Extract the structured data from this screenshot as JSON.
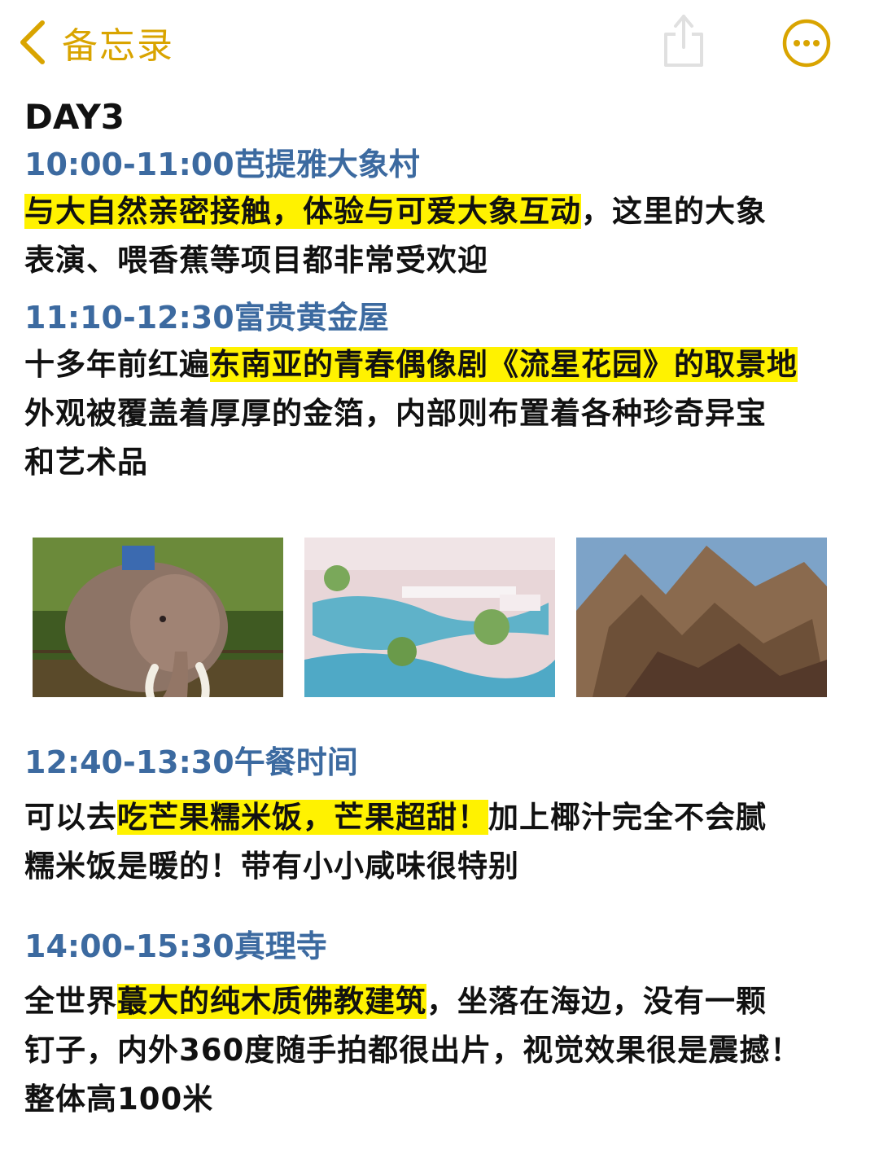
{
  "header": {
    "back_label": "备忘录",
    "accent_color": "#d9a400",
    "icons": [
      "chevron-left-icon",
      "share-icon",
      "more-icon"
    ]
  },
  "note": {
    "day_title": "DAY3",
    "sections": [
      {
        "time": "10:00-11:00芭提雅大象村",
        "lines": [
          {
            "hl": "与大自然亲密接触，体验与可爱大象互动",
            "rest": "，这里的大象"
          },
          {
            "pre": "表演、喂香蕉等项目都非常受欢迎"
          }
        ]
      },
      {
        "time": "11:10-12:30富贵黄金屋",
        "lines": [
          {
            "pre": "十多年前红遍",
            "hl": "东南亚的青春偶像剧《流星花园》的取景地"
          },
          {
            "pre": "外观被覆盖着厚厚的金箔，内部则布置着各种珍奇异宝"
          },
          {
            "pre": "和艺术品"
          }
        ]
      },
      {
        "time": "12:40-13:30午餐时间",
        "lines": [
          {
            "pre": "可以去",
            "hl": "吃芒果糯米饭，芒果超甜！",
            "rest": "加上椰汁完全不会腻"
          },
          {
            "pre": "糯米饭是暖的！带有小小咸味很特别"
          }
        ]
      },
      {
        "time": "14:00-15:30真理寺",
        "lines": [
          {
            "pre": "全世界",
            "hl": "蕞大的纯木质佛教建筑",
            "rest": "，坐落在海边，没有一颗"
          },
          {
            "pre": "钉子，内外360度随手拍都很出片，视觉效果很是震撼！"
          },
          {
            "pre": "整体高100米"
          }
        ]
      }
    ],
    "photos": [
      "elephant-photo",
      "golden-house-garden-photo",
      "sanctuary-of-truth-photo"
    ]
  }
}
